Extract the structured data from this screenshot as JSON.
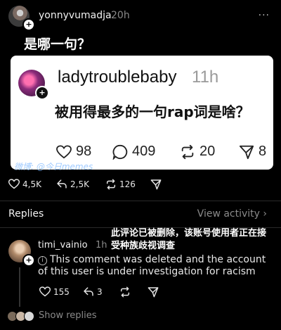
{
  "post": {
    "username": "yonnyvumadja",
    "time": "20h",
    "text": "是哪一句？",
    "more": "···",
    "stats": {
      "likes": "4,5K",
      "reposts": "2,5K",
      "quotes": "126"
    }
  },
  "quoted": {
    "username": "ladytroublebaby",
    "time": "11h",
    "text": "被用得最多的一句rap词是啥？",
    "more": "···",
    "likes": "98",
    "comments": "409",
    "reposts": "20",
    "shares": "8"
  },
  "watermark": "微博: @今日memes",
  "replies_header": {
    "label": "Replies",
    "view_activity": "View activity ›"
  },
  "reply": {
    "username": "timi_vainio",
    "time": "1h",
    "text": "This comment was deleted and the account of this user is under investigation for racism",
    "overlay_cn": "此评论已被删除，该账号使用者正在接受种族歧视调查",
    "more": "···",
    "likes": "155",
    "reposts": "3"
  },
  "show_replies": "Show replies",
  "colors": {
    "background": "#000000",
    "card": "#ffffff",
    "muted": "#8a8a8a"
  }
}
